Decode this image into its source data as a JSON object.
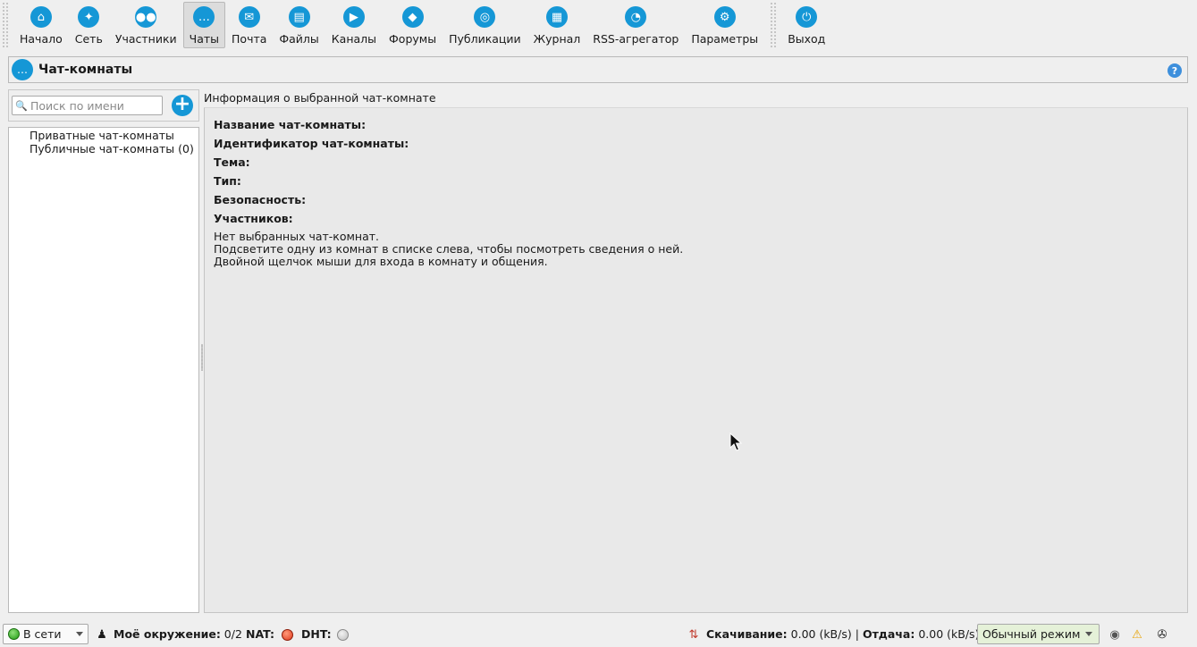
{
  "toolbar": {
    "items": [
      {
        "label": "Начало",
        "icon": "home-icon"
      },
      {
        "label": "Сеть",
        "icon": "network-icon"
      },
      {
        "label": "Участники",
        "icon": "people-icon"
      },
      {
        "label": "Чаты",
        "icon": "chat-icon",
        "active": true
      },
      {
        "label": "Почта",
        "icon": "mail-icon"
      },
      {
        "label": "Файлы",
        "icon": "files-icon"
      },
      {
        "label": "Каналы",
        "icon": "channels-icon"
      },
      {
        "label": "Форумы",
        "icon": "forums-icon"
      },
      {
        "label": "Публикации",
        "icon": "posted-icon"
      },
      {
        "label": "Журнал",
        "icon": "log-icon"
      },
      {
        "label": "RSS-агрегатор",
        "icon": "rss-icon"
      },
      {
        "label": "Параметры",
        "icon": "gear-icon"
      },
      {
        "label": "Выход",
        "icon": "power-icon"
      }
    ]
  },
  "page": {
    "title": "Чат-комнаты",
    "help": "?"
  },
  "left": {
    "search_placeholder": "Поиск по имени",
    "add_symbol": "+",
    "tree": [
      "Приватные чат-комнаты",
      "Публичные чат-комнаты (0)"
    ]
  },
  "info": {
    "caption": "Информация о выбранной чат-комнате",
    "fields": [
      "Название чат-комнаты:",
      "Идентификатор чат-комнаты:",
      "Тема:",
      "Тип:",
      "Безопасность:",
      "Участников:"
    ],
    "message_lines": [
      "Нет выбранных чат-комнат.",
      "Подсветите одну из комнат в списке слева, чтобы посмотреть сведения о ней.",
      "Двойной щелчок мыши для входа в комнату и общения."
    ]
  },
  "status": {
    "online_label": "В сети",
    "friends_label": "Моё окружение:",
    "friends_value": "0/2",
    "nat_label": "NAT:",
    "dht_label": "DHT:",
    "down_label": "Скачивание:",
    "down_value": "0.00 (kB/s)",
    "separator": "|",
    "up_label": "Отдача:",
    "up_value": "0.00 (kB/s)",
    "mode_label": "Обычный режим",
    "colors": {
      "nat": "#e03a1e",
      "dht": "#c8c8c8",
      "accent": "#1597d6"
    }
  }
}
